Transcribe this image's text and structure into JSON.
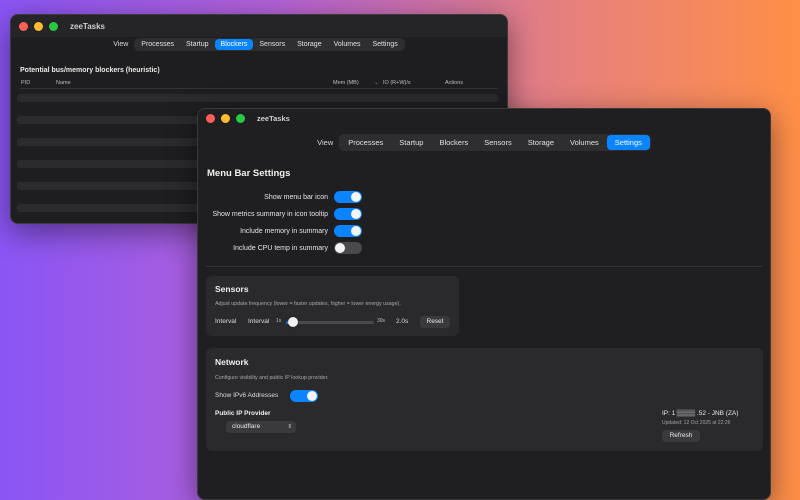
{
  "back_window": {
    "title": "zeeTasks",
    "view_label": "View",
    "tabs": [
      {
        "label": "Processes",
        "active": false
      },
      {
        "label": "Startup",
        "active": false
      },
      {
        "label": "Blockers",
        "active": true
      },
      {
        "label": "Sensors",
        "active": false
      },
      {
        "label": "Storage",
        "active": false
      },
      {
        "label": "Volumes",
        "active": false
      },
      {
        "label": "Settings",
        "active": false
      }
    ],
    "heading": "Potential bus/memory blockers (heuristic)",
    "columns": {
      "pid": "PID",
      "name": "Name",
      "mem": "Mem (MB)",
      "io": "IO (R+W)/s",
      "actions": "Actions"
    }
  },
  "front_window": {
    "title": "zeeTasks",
    "view_label": "View",
    "tabs": [
      {
        "label": "Processes",
        "active": false
      },
      {
        "label": "Startup",
        "active": false
      },
      {
        "label": "Blockers",
        "active": false
      },
      {
        "label": "Sensors",
        "active": false
      },
      {
        "label": "Storage",
        "active": false
      },
      {
        "label": "Volumes",
        "active": false
      },
      {
        "label": "Settings",
        "active": true
      }
    ],
    "menu_bar": {
      "title": "Menu Bar Settings",
      "toggles": [
        {
          "label": "Show menu bar icon",
          "on": true
        },
        {
          "label": "Show metrics summary in icon tooltip",
          "on": true
        },
        {
          "label": "Include memory in summary",
          "on": true
        },
        {
          "label": "Include CPU temp in summary",
          "on": false
        }
      ]
    },
    "sensors": {
      "title": "Sensors",
      "subtitle": "Adjust update frequency (lower = faster updates, higher = lower energy usage).",
      "interval_label_outer": "Interval",
      "interval_label_inner": "Interval",
      "min_label": "1s",
      "max_label": "30s",
      "value_text": "2.0s",
      "value_fraction": 0.034,
      "reset_label": "Reset"
    },
    "network": {
      "title": "Network",
      "subtitle": "Configure visibility and public IP lookup provider.",
      "ipv6_label": "Show IPv6 Addresses",
      "ipv6_on": true,
      "provider_label": "Public IP Provider",
      "provider_value": "cloudflare",
      "ip_text": "IP: 1 ▒▒▒▒ .52 - JNB (ZA)",
      "updated_text": "Updated: 12 Oct 2025 at 22:26",
      "refresh_label": "Refresh"
    }
  },
  "colors": {
    "accent": "#0a84ff",
    "window_bg": "#1f1f21",
    "card_bg": "#2a2a2d"
  }
}
